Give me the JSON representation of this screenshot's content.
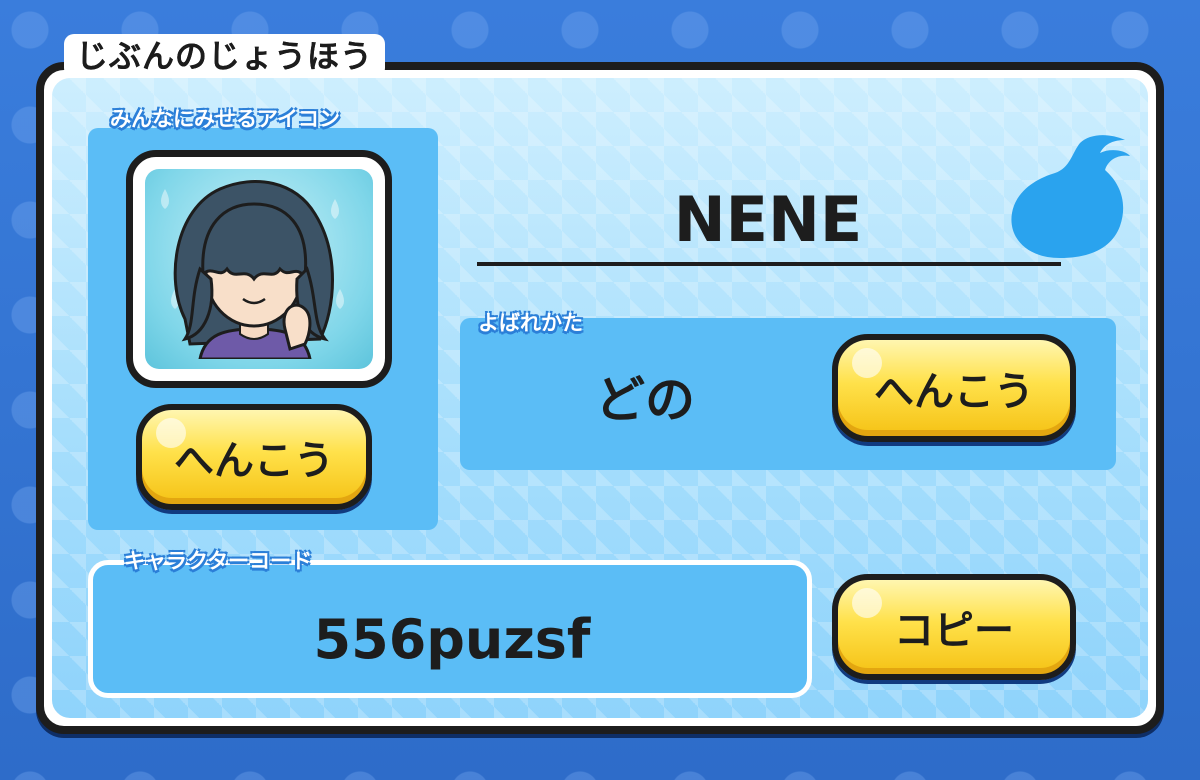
{
  "header": {
    "title": "じぶんのじょうほう"
  },
  "icon_section": {
    "label": "みんなにみせるアイコン",
    "change_button": "へんこう",
    "avatar_icon": "avatar-girl-icon"
  },
  "player": {
    "name": "NENE"
  },
  "title_section": {
    "label": "よばれかた",
    "value": "どの",
    "change_button": "へんこう"
  },
  "code_section": {
    "label": "キャラクターコード",
    "value": "556puzsf",
    "copy_button": "コピー"
  },
  "colors": {
    "background": "#2f6fd0",
    "panel": "#a6defc",
    "box": "#5bbdf6",
    "button": "#ffe14a",
    "outline": "#1d1d1d"
  },
  "decor": {
    "ghost_icon": "ghost-spirit-icon"
  }
}
